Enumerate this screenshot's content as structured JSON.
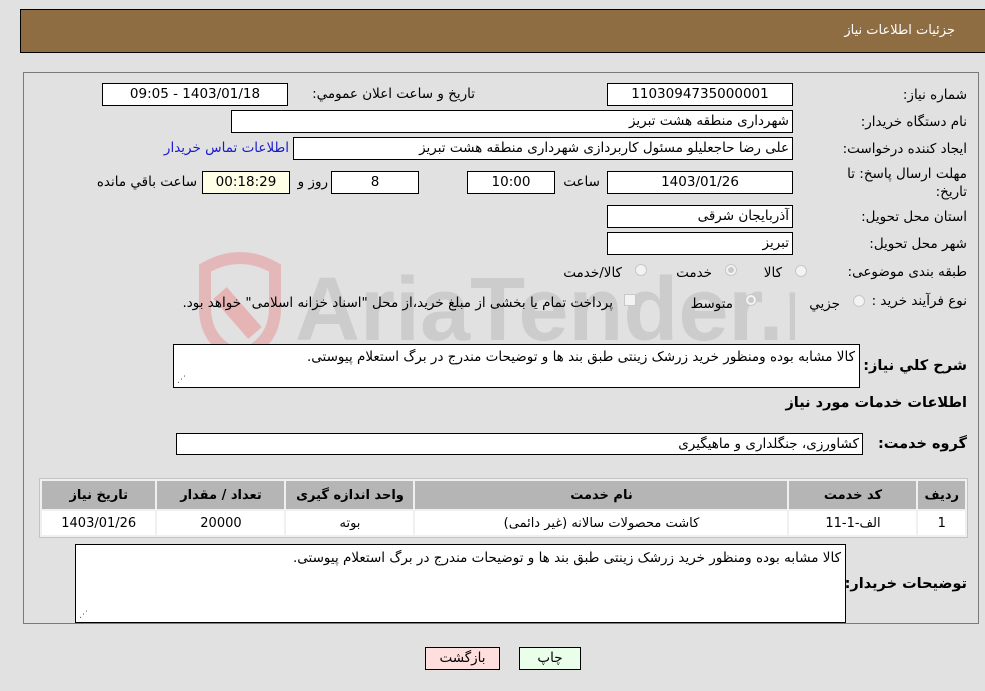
{
  "header": {
    "title": "جزئیات اطلاعات نیاز"
  },
  "form": {
    "need_number": {
      "label": "شماره نیاز:",
      "value": "1103094735000001"
    },
    "announce_datetime": {
      "label": "تاریخ و ساعت اعلان عمومي:",
      "value": "1403/01/18 - 09:05"
    },
    "buyer_org": {
      "label": "نام دستگاه خریدار:",
      "value": "شهرداری منطقه هشت تبریز"
    },
    "requester": {
      "label": "ایجاد کننده درخواست:",
      "value": "علی رضا حاجعلیلو مسئول کاربردازی شهرداری منطقه هشت تبریز"
    },
    "buyer_contact_link": "اطلاعات تماس خریدار",
    "deadline": {
      "label": "مهلت ارسال پاسخ: تا تاریخ:",
      "date": "1403/01/26",
      "time_label": "ساعت",
      "time": "10:00",
      "days": "8",
      "days_label": "روز و",
      "remaining": "00:18:29",
      "remaining_label": "ساعت باقي مانده"
    },
    "province": {
      "label": "استان محل تحویل:",
      "value": "آذربایجان شرقی"
    },
    "city": {
      "label": "شهر محل تحویل:",
      "value": "تبریز"
    },
    "category": {
      "label": "طبقه بندی موضوعی:",
      "options": [
        "کالا",
        "خدمت",
        "کالا/خدمت"
      ],
      "selected": "خدمت"
    },
    "process_type": {
      "label": "نوع فرآیند خرید :",
      "options": [
        "جزيي",
        "متوسط"
      ],
      "selected": "متوسط",
      "treasury_note": "پرداخت تمام یا بخشی از مبلغ خرید،از محل \"اسناد خزانه اسلامی\" خواهد بود."
    }
  },
  "summary": {
    "label": "شرح کلي نیاز:",
    "value": "کالا مشابه بوده ومنظور خرید زرشک زینتی طبق بند ها و توضیحات مندرج در برگ استعلام پیوستی."
  },
  "services_section": {
    "title": "اطلاعات خدمات مورد نیاز",
    "group_label": "گروه خدمت:",
    "group_value": "کشاورزی، جنگلداری و ماهیگیری"
  },
  "table": {
    "columns": [
      "ردیف",
      "کد خدمت",
      "نام خدمت",
      "واحد اندازه گیری",
      "تعداد / مقدار",
      "تاریخ نیاز"
    ],
    "rows": [
      [
        "1",
        "الف-1-11",
        "کاشت محصولات سالانه (غیر دائمی)",
        "بوته",
        "20000",
        "1403/01/26"
      ]
    ]
  },
  "buyer_notes": {
    "label": "توضیحات خریدار:",
    "value": "کالا مشابه بوده ومنظور خرید زرشک زینتی طبق بند ها و توضیحات مندرج در برگ استعلام پیوستی."
  },
  "buttons": {
    "print": "چاپ",
    "back": "بازگشت"
  },
  "watermark": {
    "text": "AriaTender.neT"
  },
  "colors": {
    "header_bg": "#8e6d42",
    "print_bg": "#eaffea",
    "back_bg": "#ffdede"
  }
}
